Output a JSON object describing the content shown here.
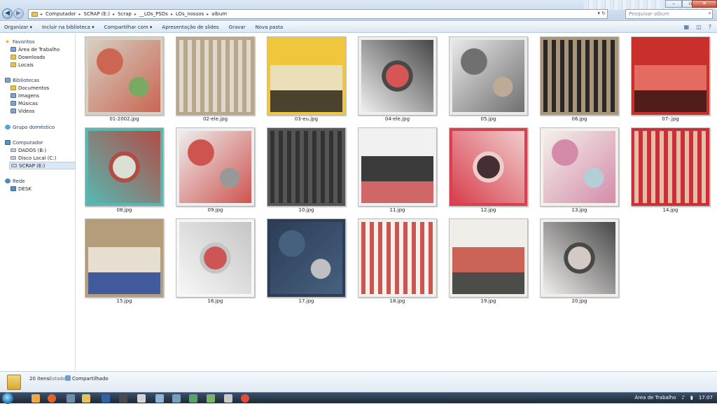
{
  "address": {
    "crumbs": [
      "Computador",
      "SCRAP (E:)",
      "Scrap",
      "__LOs_PSDs",
      "LOs_nossos",
      "album"
    ],
    "dropdown_glyph": "▾",
    "refresh_glyph": "↻"
  },
  "search": {
    "placeholder": "Pesquisar album"
  },
  "toolbar": {
    "organize": "Organizar ▾",
    "include": "Incluir na biblioteca ▾",
    "share": "Compartilhar com ▾",
    "slideshow": "Apresentação de slides",
    "burn": "Gravar",
    "new_folder": "Nova pasta"
  },
  "nav": {
    "favorites": {
      "label": "Favoritos",
      "items": [
        "Área de Trabalho",
        "Downloads",
        "Locais"
      ]
    },
    "libraries": {
      "label": "Bibliotecas",
      "items": [
        "Documentos",
        "Imagens",
        "Músicas",
        "Vídeos"
      ]
    },
    "homegroup": {
      "label": "Grupo doméstico"
    },
    "computer": {
      "label": "Computador",
      "items": [
        "DADOS (B:)",
        "Disco Local (C:)",
        "SCRAP (E:)"
      ]
    },
    "network": {
      "label": "Rede",
      "items": [
        "DESK"
      ]
    }
  },
  "files": [
    {
      "name": "01-2002.jpg",
      "colors": [
        "#d6cfc2",
        "#c9543f",
        "#6aa354"
      ]
    },
    {
      "name": "02-ele.jpg",
      "colors": [
        "#b9a78c",
        "#e6e1d6",
        "#c54a3b"
      ]
    },
    {
      "name": "03-eu.jpg",
      "colors": [
        "#f0c63c",
        "#e9e3cf",
        "#2c2a2a"
      ]
    },
    {
      "name": "04-ele.jpg",
      "colors": [
        "#efefef",
        "#2b2b2b",
        "#d23b3b"
      ]
    },
    {
      "name": "05.jpg",
      "colors": [
        "#e9e9e9",
        "#5b5b5b",
        "#b8a08a"
      ]
    },
    {
      "name": "06.jpg",
      "colors": [
        "#a8957b",
        "#151515",
        "#d8d0c0"
      ]
    },
    {
      "name": "07-.jpg",
      "colors": [
        "#c9302c",
        "#e8776a",
        "#3b1a18"
      ]
    },
    {
      "name": "08.jpg",
      "colors": [
        "#58b7b1",
        "#c23b34",
        "#f1e8dc"
      ]
    },
    {
      "name": "09.jpg",
      "colors": [
        "#eeeeee",
        "#c93a35",
        "#8a8a8a"
      ]
    },
    {
      "name": "10.jpg",
      "colors": [
        "#555555",
        "#2c2c2c",
        "#d8c33b"
      ]
    },
    {
      "name": "11.jpg",
      "colors": [
        "#f1f1f1",
        "#1b1b1b",
        "#c94f4f"
      ]
    },
    {
      "name": "12.jpg",
      "colors": [
        "#d93f4f",
        "#f4e6e2",
        "#2d2d2d"
      ]
    },
    {
      "name": "13.jpg",
      "colors": [
        "#f4f1ec",
        "#cf7a9e",
        "#a9c8d2"
      ]
    },
    {
      "name": "14.jpg",
      "colors": [
        "#cc2f3a",
        "#e9d6b8",
        "#2d2d2d"
      ]
    },
    {
      "name": "15.jpg",
      "colors": [
        "#b59d7b",
        "#efe9dd",
        "#2d4fa5"
      ]
    },
    {
      "name": "16.jpg",
      "colors": [
        "#f7f7f7",
        "#bdbdbd",
        "#c53a3a"
      ]
    },
    {
      "name": "17.jpg",
      "colors": [
        "#2d3d57",
        "#4b6887",
        "#d8d8d8"
      ]
    },
    {
      "name": "18.jpg",
      "colors": [
        "#f4f0ea",
        "#c63a3a",
        "#2b2b2b"
      ]
    },
    {
      "name": "19.jpg",
      "colors": [
        "#f1ede8",
        "#c44b3c",
        "#2f2f2f"
      ]
    },
    {
      "name": "20.jpg",
      "colors": [
        "#f1efee",
        "#2b2b2b",
        "#d0c4bf"
      ]
    }
  ],
  "status": {
    "count": "20 itens",
    "state_label": "Estado:",
    "state_value": "Compartilhado"
  },
  "taskbar": {
    "tray_label": "Área de Trabalho",
    "clock": "17:07"
  }
}
